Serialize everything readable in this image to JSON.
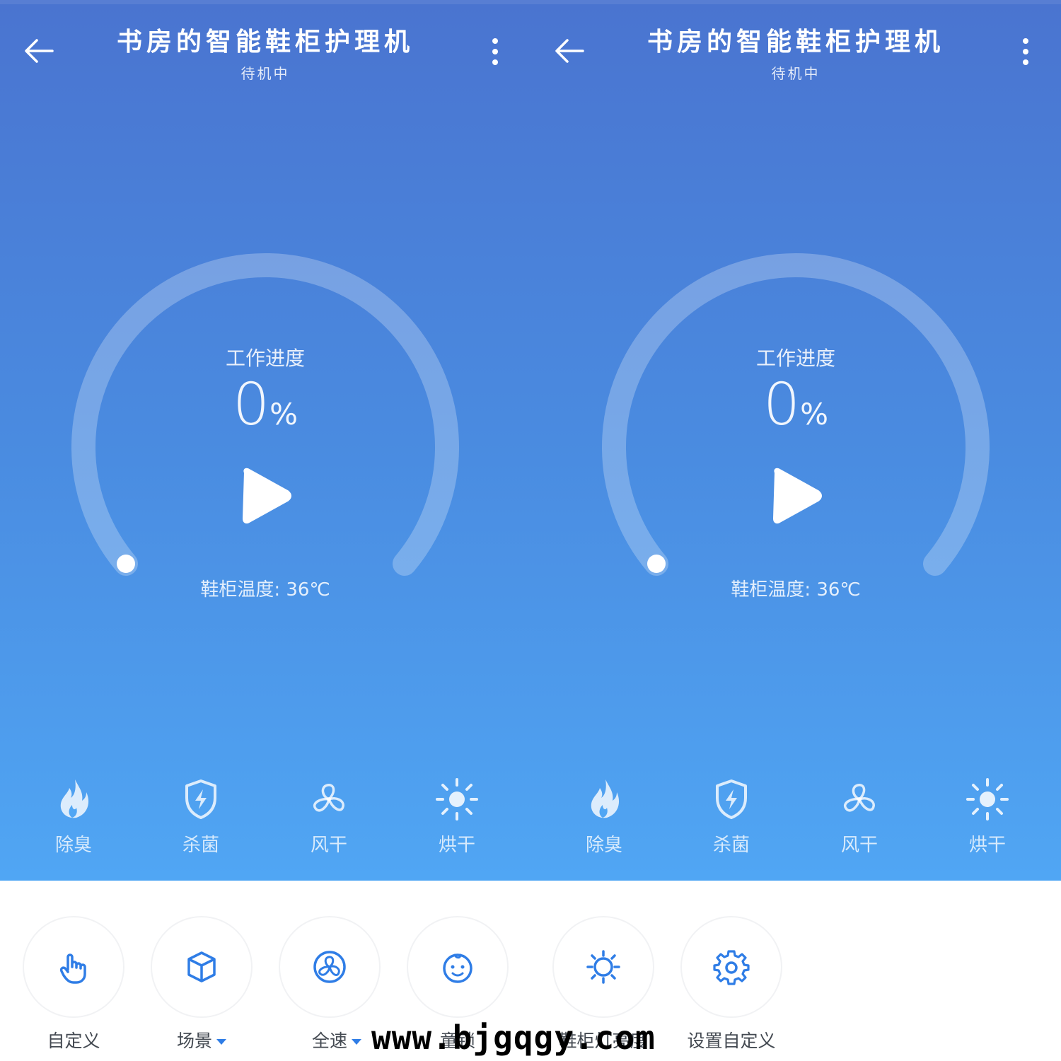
{
  "header": {
    "title": "书房的智能鞋柜护理机",
    "status": "待机中"
  },
  "gauge": {
    "label": "工作进度",
    "value": "0",
    "unit": "%",
    "progress": 0,
    "temperature_text": "鞋柜温度: 36℃"
  },
  "modes": [
    {
      "label": "除臭",
      "icon": "flame-icon"
    },
    {
      "label": "杀菌",
      "icon": "shield-bolt-icon"
    },
    {
      "label": "风干",
      "icon": "fan-icon"
    },
    {
      "label": "烘干",
      "icon": "sun-icon"
    }
  ],
  "controls": [
    {
      "label": "自定义",
      "icon": "hand-touch-icon",
      "has_dropdown": false
    },
    {
      "label": "场景",
      "icon": "cube-icon",
      "has_dropdown": true
    },
    {
      "label": "全速",
      "icon": "fan-speed-icon",
      "has_dropdown": true
    },
    {
      "label": "童锁",
      "icon": "baby-face-icon",
      "has_dropdown": false
    },
    {
      "label": "鞋柜灯亮度",
      "icon": "brightness-icon",
      "has_dropdown": false
    },
    {
      "label": "设置自定义",
      "icon": "gear-icon",
      "has_dropdown": false
    }
  ],
  "watermark": "www.bjgqgy.com",
  "colors": {
    "header_gradient_top": "#4a74d0",
    "header_gradient_bottom": "#50a6f4",
    "accent": "#2f7de6",
    "text_white": "#ffffff"
  }
}
